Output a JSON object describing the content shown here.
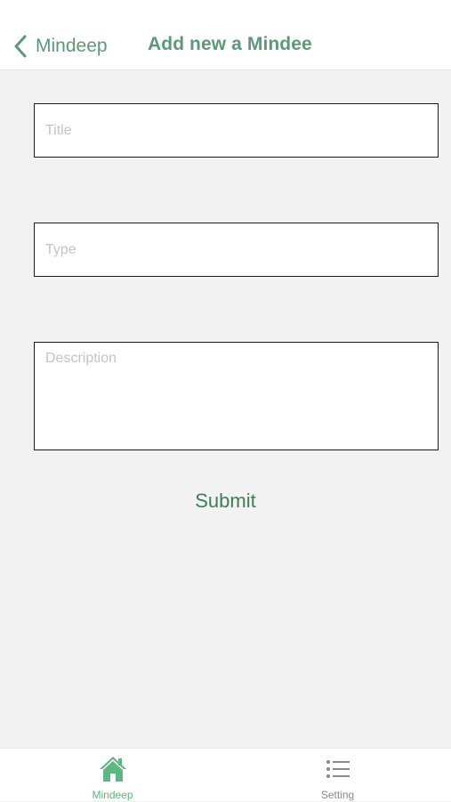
{
  "navbar": {
    "back_label": "Mindeep",
    "title": "Add new a Mindee"
  },
  "form": {
    "title_placeholder": "Title",
    "type_placeholder": "Type",
    "description_placeholder": "Description",
    "submit_label": "Submit"
  },
  "tabbar": {
    "tabs": [
      {
        "label": "Mindeep",
        "icon": "home-icon",
        "active": true
      },
      {
        "label": "Setting",
        "icon": "list-icon",
        "active": false
      }
    ]
  },
  "colors": {
    "accent": "#5a9a76",
    "active_tab": "#5cb881",
    "inactive_tab": "#8a8a8a",
    "background": "#f2f2f2"
  }
}
